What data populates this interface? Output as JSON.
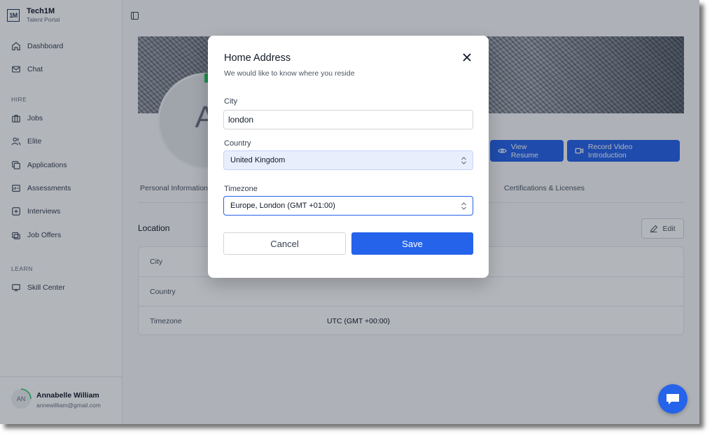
{
  "brand": {
    "logo_text": "1M",
    "name": "Tech1M",
    "subtitle": "Talent Portal"
  },
  "sidebar": {
    "items": [
      {
        "label": "Dashboard",
        "icon": "home-icon"
      },
      {
        "label": "Chat",
        "icon": "mail-icon"
      }
    ],
    "hire_heading": "HIRE",
    "hire_items": [
      {
        "label": "Jobs",
        "icon": "briefcase-icon"
      },
      {
        "label": "Elite",
        "icon": "users-icon"
      },
      {
        "label": "Applications",
        "icon": "copy-icon"
      },
      {
        "label": "Assessments",
        "icon": "assessment-icon"
      },
      {
        "label": "Interviews",
        "icon": "interview-icon"
      },
      {
        "label": "Job Offers",
        "icon": "offers-icon"
      }
    ],
    "learn_heading": "LEARN",
    "learn_items": [
      {
        "label": "Skill Center",
        "icon": "monitor-icon"
      }
    ]
  },
  "user": {
    "initials": "AN",
    "name": "Annabelle William",
    "email": "annewilliam@gmail.com"
  },
  "profile": {
    "avatar_initials": "AN",
    "view_resume_label": "View Resume",
    "record_video_label": "Record Video Introduction"
  },
  "tabs": {
    "personal_information": "Personal Information",
    "certifications": "Certifications & Licenses"
  },
  "location": {
    "title": "Location",
    "edit_label": "Edit",
    "rows": [
      {
        "label": "City",
        "value": ""
      },
      {
        "label": "Country",
        "value": ""
      },
      {
        "label": "Timezone",
        "value": "UTC (GMT +00:00)"
      }
    ]
  },
  "modal": {
    "title": "Home Address",
    "subtitle": "We would like to know where you reside",
    "city_label": "City",
    "city_value": "london",
    "country_label": "Country",
    "country_value": "United Kingdom",
    "timezone_label": "Timezone",
    "timezone_value": "Europe, London (GMT +01:00)",
    "cancel_label": "Cancel",
    "save_label": "Save"
  },
  "colors": {
    "accent": "#2563eb",
    "overlay": "rgba(17,24,39,0.32)"
  }
}
